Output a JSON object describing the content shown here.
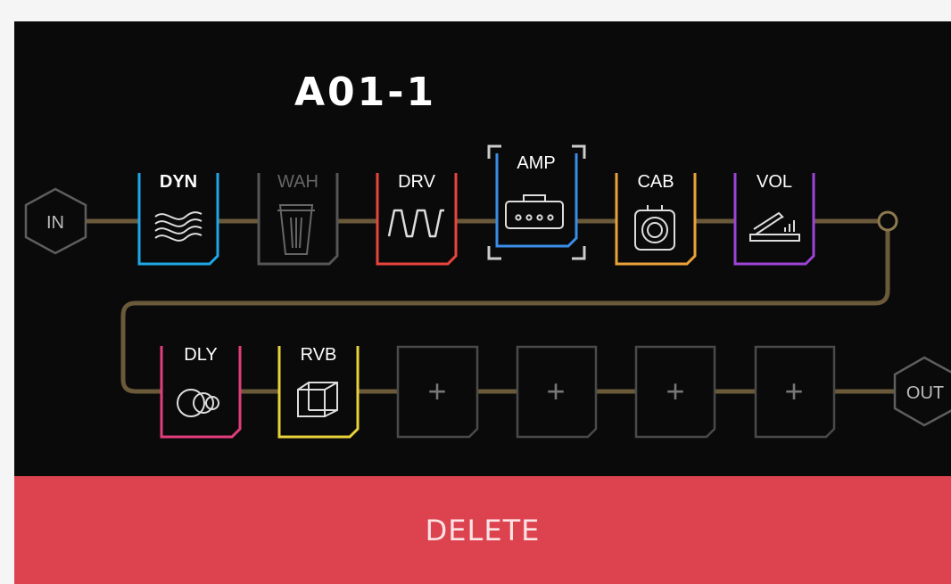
{
  "preset": {
    "name": "A01-1"
  },
  "io": {
    "input_label": "IN",
    "output_label": "OUT"
  },
  "row1": [
    {
      "label": "DYN",
      "icon": "wave-icon",
      "color": "#1ea7e6",
      "bypassed": false
    },
    {
      "label": "WAH",
      "icon": "wah-pedal-icon",
      "color": "#555555",
      "bypassed": true
    },
    {
      "label": "DRV",
      "icon": "square-wave-icon",
      "color": "#e8443e",
      "bypassed": false
    },
    {
      "label": "AMP",
      "icon": "amp-head-icon",
      "color": "#3a8ee8",
      "bypassed": false,
      "selected": true
    },
    {
      "label": "CAB",
      "icon": "speaker-cabinet-icon",
      "color": "#e9a23b",
      "bypassed": false
    },
    {
      "label": "VOL",
      "icon": "volume-pedal-icon",
      "color": "#9b44d6",
      "bypassed": false
    }
  ],
  "row2": [
    {
      "label": "DLY",
      "icon": "delay-circles-icon",
      "color": "#e23d7c",
      "bypassed": false
    },
    {
      "label": "RVB",
      "icon": "reverb-cube-icon",
      "color": "#e8d23a",
      "bypassed": false
    }
  ],
  "empty_slot_symbol": "+",
  "actions": {
    "delete_label": "DELETE"
  },
  "colors": {
    "cable": "#6b5a3a",
    "empty_slot": "#4a4a4a",
    "delete": "#dd434f",
    "selection": "#cccccc"
  }
}
